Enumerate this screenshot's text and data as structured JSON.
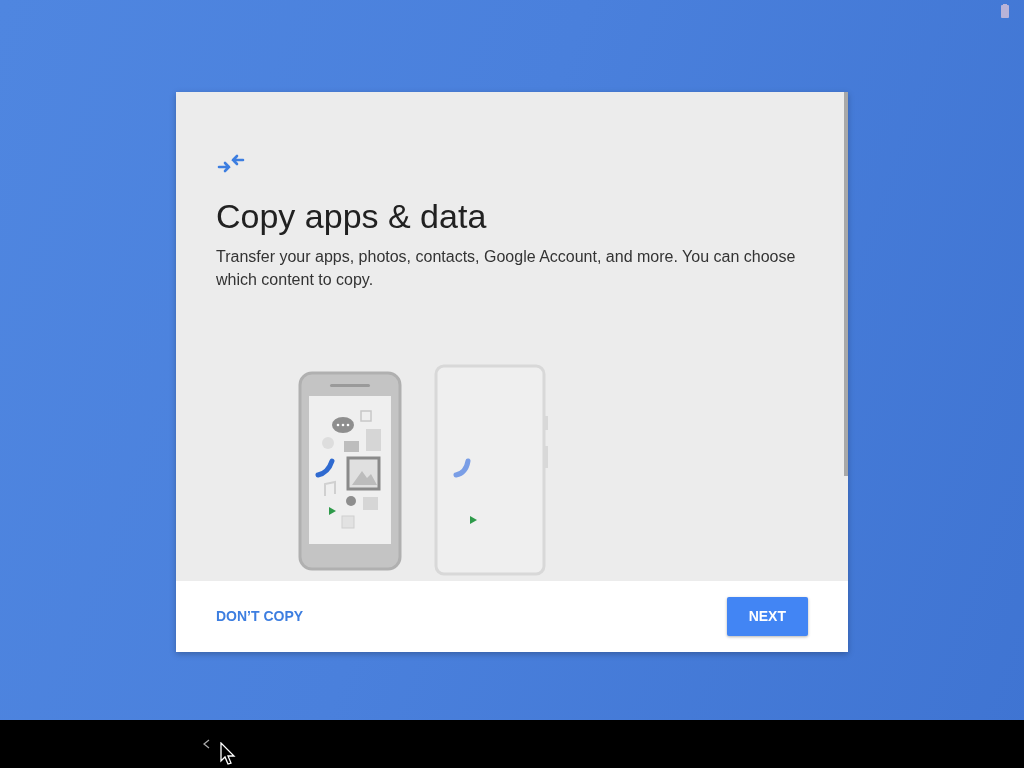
{
  "dialog": {
    "title": "Copy apps & data",
    "description": "Transfer your apps, photos, contacts, Google Account, and more. You can choose which content to copy.",
    "buttons": [
      {
        "label": "DON’T COPY",
        "kind": "text"
      },
      {
        "label": "NEXT",
        "kind": "primary"
      }
    ]
  }
}
